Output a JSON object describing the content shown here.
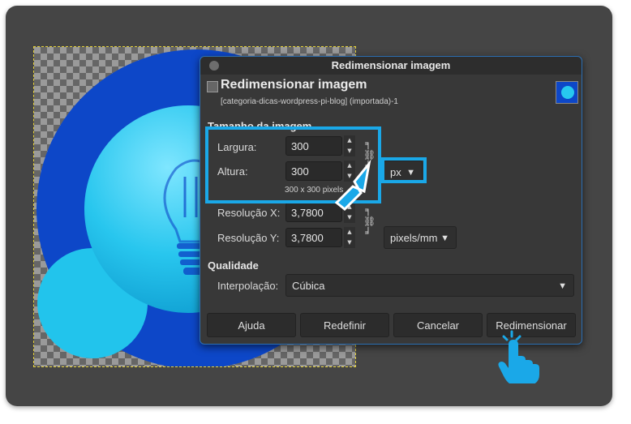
{
  "dialog": {
    "window_title": "Redimensionar imagem",
    "header_title": "Redimensionar imagem",
    "header_subtitle": "[categoria-dicas-wordpress-pi-blog] (importada)-1"
  },
  "image_size": {
    "section_label": "Tamanho da imagem",
    "width_label": "Largura:",
    "width_value": "300",
    "height_label": "Altura:",
    "height_value": "300",
    "unit": "px",
    "summary": "300 x 300 pixels",
    "res_x_label": "Resolução X:",
    "res_x_value": "3,7800",
    "res_y_label": "Resolução Y:",
    "res_y_value": "3,7800",
    "res_unit": "pixels/mm"
  },
  "quality": {
    "section_label": "Qualidade",
    "interp_label": "Interpolação:",
    "interp_value": "Cúbica"
  },
  "buttons": {
    "help": "Ajuda",
    "reset": "Redefinir",
    "cancel": "Cancelar",
    "resize": "Redimensionar"
  },
  "colors": {
    "highlight": "#1aa8e8",
    "canvas_blue": "#0d47c8",
    "bulb_cyan": "#27c8ef"
  }
}
